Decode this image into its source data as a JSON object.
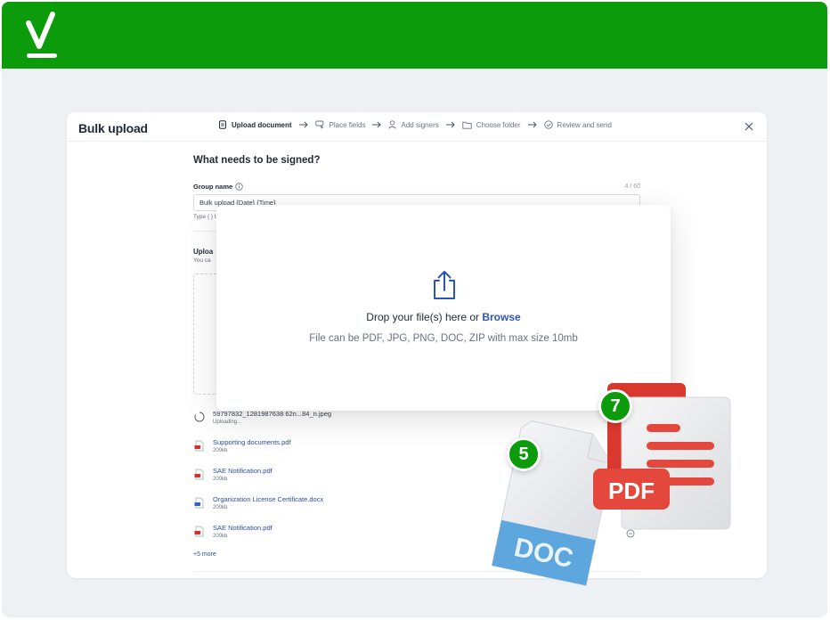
{
  "header": {
    "logo_icon": "checkmark-logo-icon",
    "brand_color": "#0b9b0b"
  },
  "dialog": {
    "title": "Bulk upload",
    "steps": [
      {
        "label": "Upload document",
        "icon": "document-icon",
        "active": true
      },
      {
        "label": "Place fields",
        "icon": "place-fields-icon",
        "active": false
      },
      {
        "label": "Add signers",
        "icon": "person-icon",
        "active": false
      },
      {
        "label": "Choose folder",
        "icon": "folder-icon",
        "active": false
      },
      {
        "label": "Review and send",
        "icon": "check-circle-icon",
        "active": false
      }
    ],
    "close_icon": "close-icon"
  },
  "form": {
    "heading": "What needs to be signed?",
    "group_name_label": "Group name",
    "group_name_counter": "4 / 60",
    "group_name_value": "Bulk upload {Date} {Time}",
    "group_name_hint": "Type { } t",
    "upload_label": "Uploa",
    "upload_hint": "You ca"
  },
  "files": [
    {
      "name": "59797832_1281987638 62n...84_n.jpeg",
      "size": "Uploading...",
      "type": "uploading"
    },
    {
      "name": "Supporting documents.pdf",
      "size": "200kb",
      "type": "pdf"
    },
    {
      "name": "SAE Notification.pdf",
      "size": "200kb",
      "type": "pdf"
    },
    {
      "name": "Organization License Certificate.docx",
      "size": "200kb",
      "type": "docx"
    },
    {
      "name": "SAE Notification.pdf",
      "size": "200kb",
      "type": "pdf"
    }
  ],
  "more_files": "+5 more",
  "dropzone": {
    "icon": "upload-icon",
    "text": "Drop your file(s) here or ",
    "browse": "Browse",
    "subtext": "File can be PDF, JPG, PNG, DOC, ZIP with max size 10mb"
  },
  "decor": {
    "doc_label": "DOC",
    "pdf_label": "PDF",
    "badge_doc": "5",
    "badge_pdf": "7"
  }
}
